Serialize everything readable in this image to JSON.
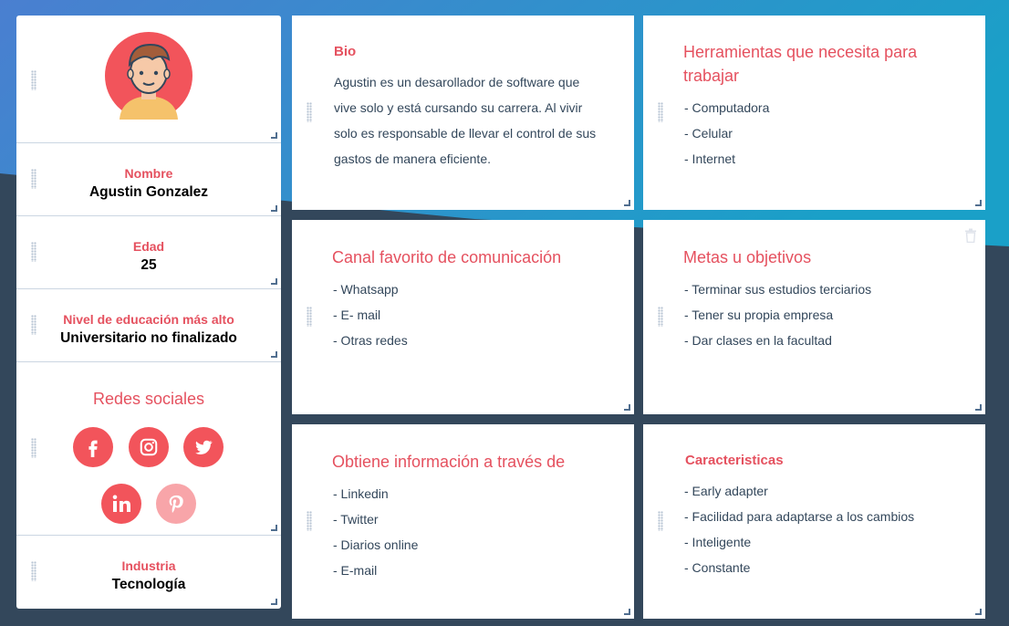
{
  "colors": {
    "accent": "#e5515f",
    "social_active": "#f2545b",
    "social_inactive": "#f8a5a9",
    "background_dark": "#33475b",
    "background_blue": "#1a9bd0"
  },
  "profile": {
    "avatar_icon": "user-avatar-icon",
    "nombre_label": "Nombre",
    "nombre_value": "Agustin Gonzalez",
    "edad_label": "Edad",
    "edad_value": "25",
    "educacion_label": "Nivel de educación más alto",
    "educacion_value": "Universitario no finalizado",
    "redes_title": "Redes sociales",
    "social_icons": [
      "facebook-icon",
      "instagram-icon",
      "twitter-icon",
      "linkedin-icon",
      "pinterest-icon"
    ],
    "industria_label": "Industria",
    "industria_value": "Tecnología"
  },
  "cards": {
    "bio": {
      "title": "Bio",
      "text": "Agustin es un desarollador de software que vive solo y está cursando su carrera. Al vivir solo es responsable de llevar el control de sus gastos de manera eficiente."
    },
    "herramientas": {
      "title": "Herramientas que necesita para trabajar",
      "items": [
        "- Computadora",
        "- Celular",
        "- Internet"
      ]
    },
    "canal": {
      "title": "Canal favorito de comunicación",
      "items": [
        "- Whatsapp",
        "- E- mail",
        "- Otras redes"
      ]
    },
    "metas": {
      "title": "Metas u objetivos",
      "items": [
        "- Terminar sus estudios terciarios",
        "- Tener su propia empresa",
        "- Dar clases en la facultad"
      ]
    },
    "informacion": {
      "title": "Obtiene información a través de",
      "items": [
        "- Linkedin",
        "- Twitter",
        "- Diarios online",
        "- E-mail"
      ]
    },
    "caracteristicas": {
      "title": "Caracteristicas",
      "items": [
        "- Early adapter",
        "- Facilidad para adaptarse a los cambios",
        "- Inteligente",
        "- Constante"
      ]
    }
  }
}
